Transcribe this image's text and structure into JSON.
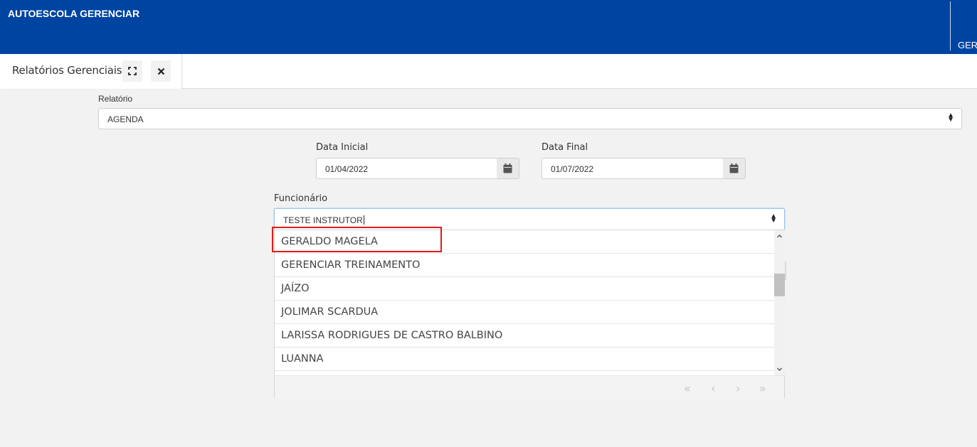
{
  "app": {
    "title": "AUTOESCOLA GERENCIAR",
    "user_label": "GER"
  },
  "tab": {
    "label": "Relatórios Gerenciais",
    "expand_icon": "expand-icon",
    "close_icon": "close-icon"
  },
  "form": {
    "relatorio": {
      "label": "Relatório",
      "value": "AGENDA"
    },
    "data_inicial": {
      "label": "Data Inicial",
      "value": "01/04/2022"
    },
    "data_final": {
      "label": "Data Final",
      "value": "01/07/2022"
    },
    "funcionario": {
      "label": "Funcionário",
      "value": "TESTE INSTRUTOR",
      "options": [
        "GERALDO MAGELA",
        "GERENCIAR TREINAMENTO",
        "JAÍZO",
        "JOLIMAR SCARDUA",
        "LARISSA RODRIGUES DE CASTRO BALBINO",
        "LUANNA"
      ],
      "highlighted_option": "GERALDO MAGELA"
    }
  },
  "pager": {
    "first": "«",
    "prev": "‹",
    "next": "›",
    "last": "»"
  },
  "colors": {
    "header": "#0044a2",
    "highlight": "#e3191b"
  }
}
